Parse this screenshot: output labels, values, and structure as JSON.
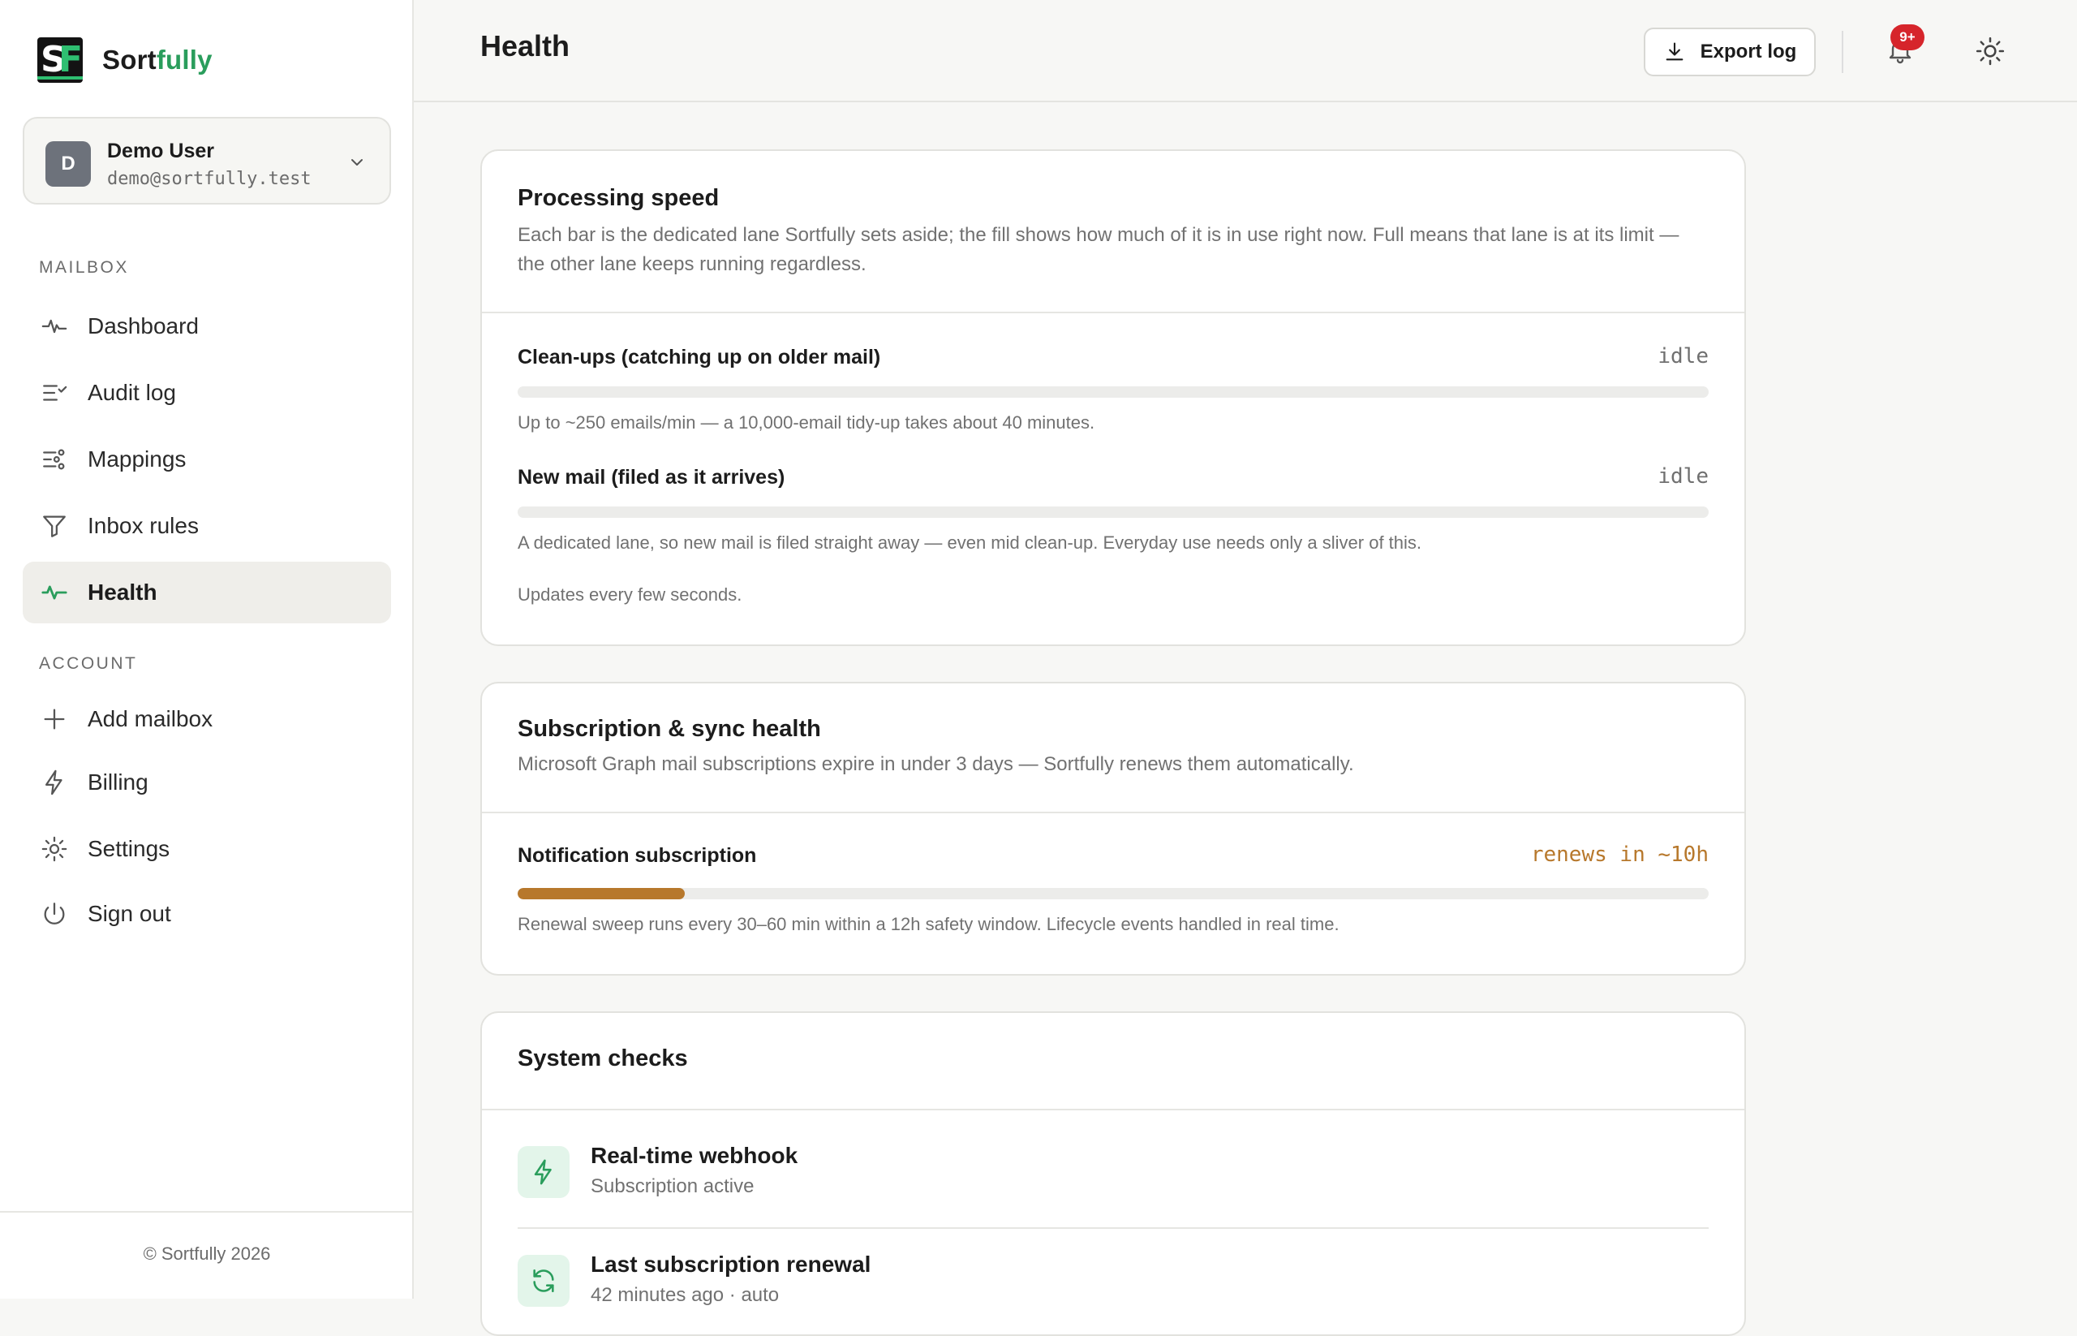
{
  "brand": {
    "name_part1": "Sort",
    "name_part2": "fully",
    "logo_s": "S",
    "logo_f": "F"
  },
  "user": {
    "initial": "D",
    "name": "Demo User",
    "email": "demo@sortfully.test"
  },
  "sidebar": {
    "mailbox_label": "MAILBOX",
    "mailbox_items": [
      {
        "label": "Dashboard",
        "icon": "activity-icon"
      },
      {
        "label": "Audit log",
        "icon": "list-check-icon"
      },
      {
        "label": "Mappings",
        "icon": "sliders-icon"
      },
      {
        "label": "Inbox rules",
        "icon": "filter-icon"
      },
      {
        "label": "Health",
        "icon": "pulse-icon",
        "active": true
      }
    ],
    "account_label": "ACCOUNT",
    "account_items": [
      {
        "label": "Add mailbox",
        "icon": "plus-icon"
      },
      {
        "label": "Billing",
        "icon": "bolt-icon"
      },
      {
        "label": "Settings",
        "icon": "gear-icon"
      },
      {
        "label": "Sign out",
        "icon": "power-icon"
      }
    ],
    "copyright": "© Sortfully 2026"
  },
  "header": {
    "title": "Health",
    "export_label": "Export log",
    "notification_badge": "9+"
  },
  "processing": {
    "title": "Processing speed",
    "description": "Each bar is the dedicated lane Sortfully sets aside; the fill shows how much of it is in use right now. Full means that lane is at its limit — the other lane keeps running regardless.",
    "lanes": [
      {
        "label": "Clean-ups (catching up on older mail)",
        "status": "idle",
        "usage_fraction": 0,
        "note": "Up to ~250 emails/min — a 10,000-email tidy-up takes about 40 minutes."
      },
      {
        "label": "New mail (filed as it arrives)",
        "status": "idle",
        "usage_fraction": 0,
        "note": "A dedicated lane, so new mail is filed straight away — even mid clean-up. Everyday use needs only a sliver of this."
      }
    ],
    "footer_note": "Updates every few seconds."
  },
  "subscription": {
    "title": "Subscription & sync health",
    "description": "Microsoft Graph mail subscriptions expire in under 3 days — Sortfully renews them automatically.",
    "row_label": "Notification subscription",
    "row_status": "renews in ~10h",
    "progress_fraction": 0.14,
    "progress_color": "#b7782c",
    "note": "Renewal sweep runs every 30–60 min within a 12h safety window. Lifecycle events handled in real time."
  },
  "system_checks": {
    "title": "System checks",
    "items": [
      {
        "title": "Real-time webhook",
        "subtitle": "Subscription active",
        "icon": "bolt-icon"
      },
      {
        "title": "Last subscription renewal",
        "subtitle": "42 minutes ago · auto",
        "icon": "refresh-icon"
      }
    ]
  },
  "colors": {
    "accent_green": "#2a9d5c",
    "warning": "#b7782c",
    "badge_red": "#d6252b"
  }
}
